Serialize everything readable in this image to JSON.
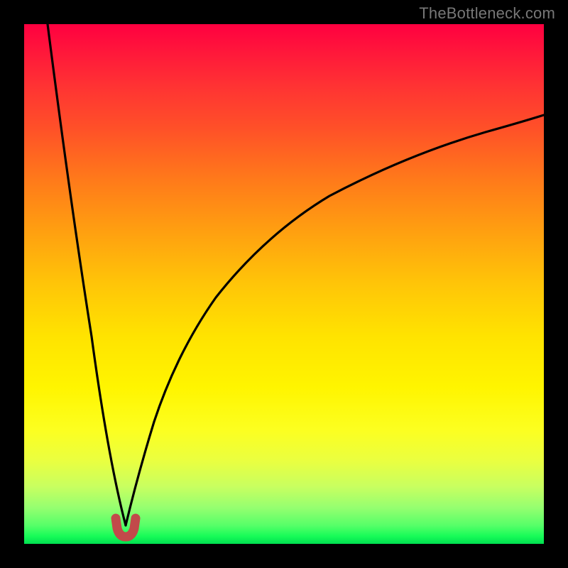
{
  "watermark": "TheBottleneck.com",
  "colors": {
    "frame": "#000000",
    "curve": "#000000",
    "marker": "#c24a4a",
    "gradient_top": "#ff0040",
    "gradient_bottom": "#00e050"
  },
  "chart_data": {
    "type": "line",
    "title": "",
    "xlabel": "",
    "ylabel": "",
    "xlim": [
      0,
      1
    ],
    "ylim": [
      0,
      1
    ],
    "grid": false,
    "description": "Bottleneck curve: composite of a steep decreasing branch (left) and a slower-rising branch (right) meeting at a pronounced minimum near x ≈ 0.195, y ≈ 0. Vertical axis maps 0 → green (no bottleneck) at the bottom to 1 → red (severe bottleneck) at the top.",
    "minimum_point": {
      "x": 0.195,
      "y": 0.0
    },
    "series": [
      {
        "name": "left-branch",
        "x": [
          0.045,
          0.06,
          0.075,
          0.09,
          0.105,
          0.12,
          0.135,
          0.15,
          0.165,
          0.18,
          0.195
        ],
        "y": [
          1.0,
          0.86,
          0.73,
          0.61,
          0.5,
          0.4,
          0.3,
          0.21,
          0.13,
          0.06,
          0.0
        ]
      },
      {
        "name": "right-branch",
        "x": [
          0.195,
          0.22,
          0.25,
          0.29,
          0.34,
          0.4,
          0.47,
          0.55,
          0.64,
          0.74,
          0.86,
          1.0
        ],
        "y": [
          0.0,
          0.11,
          0.23,
          0.34,
          0.44,
          0.53,
          0.6,
          0.66,
          0.71,
          0.755,
          0.8,
          0.84
        ]
      }
    ],
    "marker": {
      "name": "u-marker",
      "shape": "U",
      "center_x": 0.195,
      "center_y": 0.025,
      "width": 0.045,
      "height": 0.035,
      "color": "#c24a4a"
    }
  }
}
